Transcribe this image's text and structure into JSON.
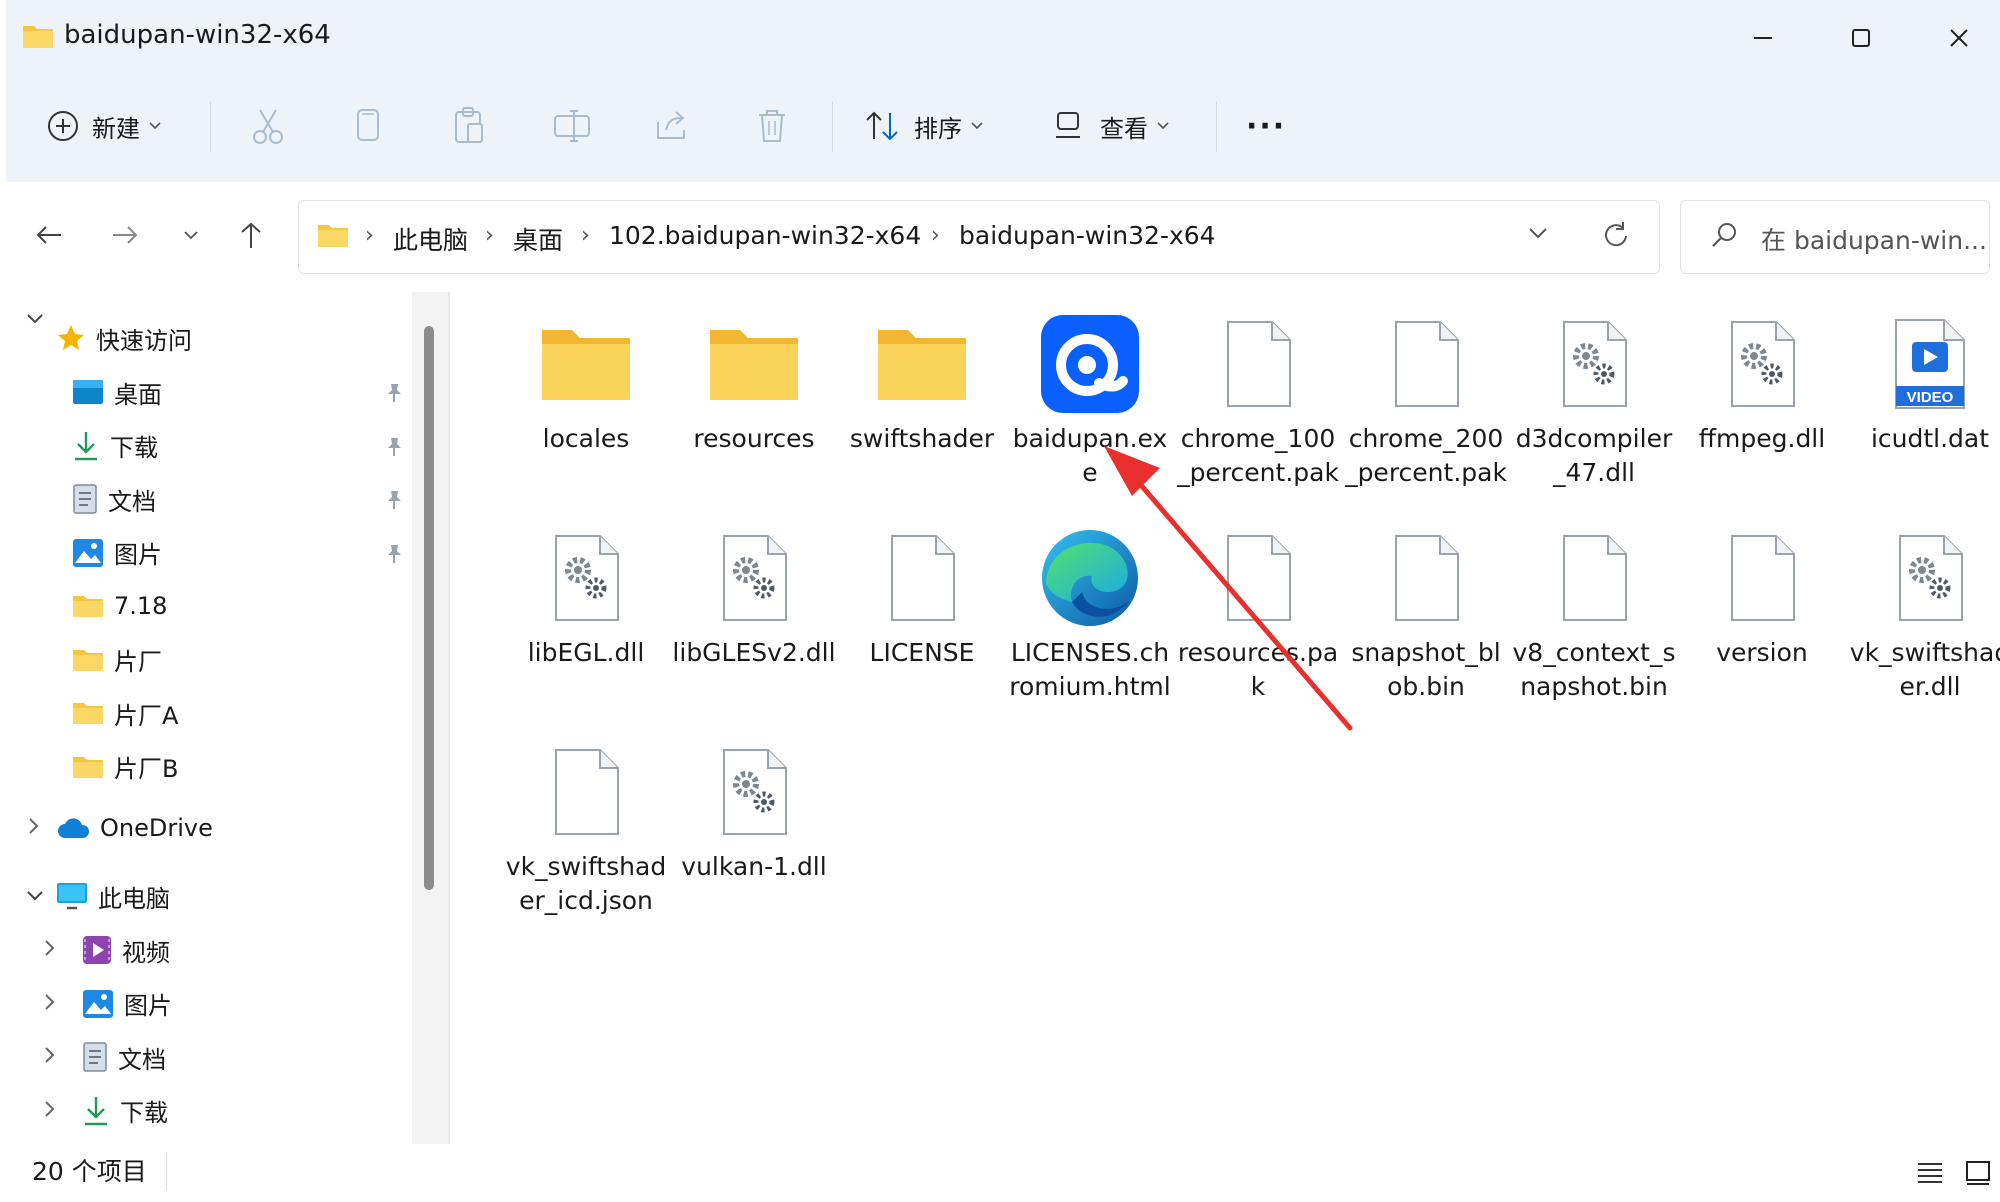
{
  "window": {
    "title": "baidupan-win32-x64"
  },
  "toolbar": {
    "new_label": "新建",
    "sort_label": "排序",
    "view_label": "查看",
    "more_label": "···"
  },
  "address": {
    "crumbs": [
      "此电脑",
      "桌面",
      "102.baidupan-win32-x64",
      "baidupan-win32-x64"
    ],
    "search_placeholder": "在 baidupan-win..."
  },
  "sidebar": {
    "quick_access": "快速访问",
    "quick_items": [
      {
        "label": "桌面",
        "icon": "desktop-icon",
        "pinned": true
      },
      {
        "label": "下载",
        "icon": "download-icon",
        "pinned": true
      },
      {
        "label": "文档",
        "icon": "document-icon",
        "pinned": true
      },
      {
        "label": "图片",
        "icon": "picture-icon",
        "pinned": true
      },
      {
        "label": "7.18",
        "icon": "folder-icon",
        "pinned": false
      },
      {
        "label": "片厂",
        "icon": "folder-icon",
        "pinned": false
      },
      {
        "label": "片厂A",
        "icon": "folder-icon",
        "pinned": false
      },
      {
        "label": "片厂B",
        "icon": "folder-icon",
        "pinned": false
      }
    ],
    "onedrive": "OneDrive",
    "this_pc": "此电脑",
    "pc_items": [
      {
        "label": "视频",
        "icon": "video-icon"
      },
      {
        "label": "图片",
        "icon": "picture-icon"
      },
      {
        "label": "文档",
        "icon": "document-icon"
      },
      {
        "label": "下载",
        "icon": "download-icon"
      }
    ]
  },
  "files": [
    {
      "name": "locales",
      "type": "folder"
    },
    {
      "name": "resources",
      "type": "folder"
    },
    {
      "name": "swiftshader",
      "type": "folder"
    },
    {
      "name": "baidupan.exe",
      "type": "baidu-exe"
    },
    {
      "name": "chrome_100_percent.pak",
      "type": "file"
    },
    {
      "name": "chrome_200_percent.pak",
      "type": "file"
    },
    {
      "name": "d3dcompiler_47.dll",
      "type": "dll"
    },
    {
      "name": "ffmpeg.dll",
      "type": "dll"
    },
    {
      "name": "icudtl.dat",
      "type": "video"
    },
    {
      "name": "libEGL.dll",
      "type": "dll"
    },
    {
      "name": "libGLESv2.dll",
      "type": "dll"
    },
    {
      "name": "LICENSE",
      "type": "file"
    },
    {
      "name": "LICENSES.chromium.html",
      "type": "edge"
    },
    {
      "name": "resources.pak",
      "type": "file"
    },
    {
      "name": "snapshot_blob.bin",
      "type": "file"
    },
    {
      "name": "v8_context_snapshot.bin",
      "type": "file"
    },
    {
      "name": "version",
      "type": "file"
    },
    {
      "name": "vk_swiftshader.dll",
      "type": "dll"
    },
    {
      "name": "vk_swiftshader_icd.json",
      "type": "file"
    },
    {
      "name": "vulkan-1.dll",
      "type": "dll"
    }
  ],
  "status": {
    "count": "20 个项目"
  },
  "colors": {
    "accent": "#0067c0",
    "folder": "#f7c641",
    "arrow": "#e8312f",
    "band": "#eef3f9"
  }
}
